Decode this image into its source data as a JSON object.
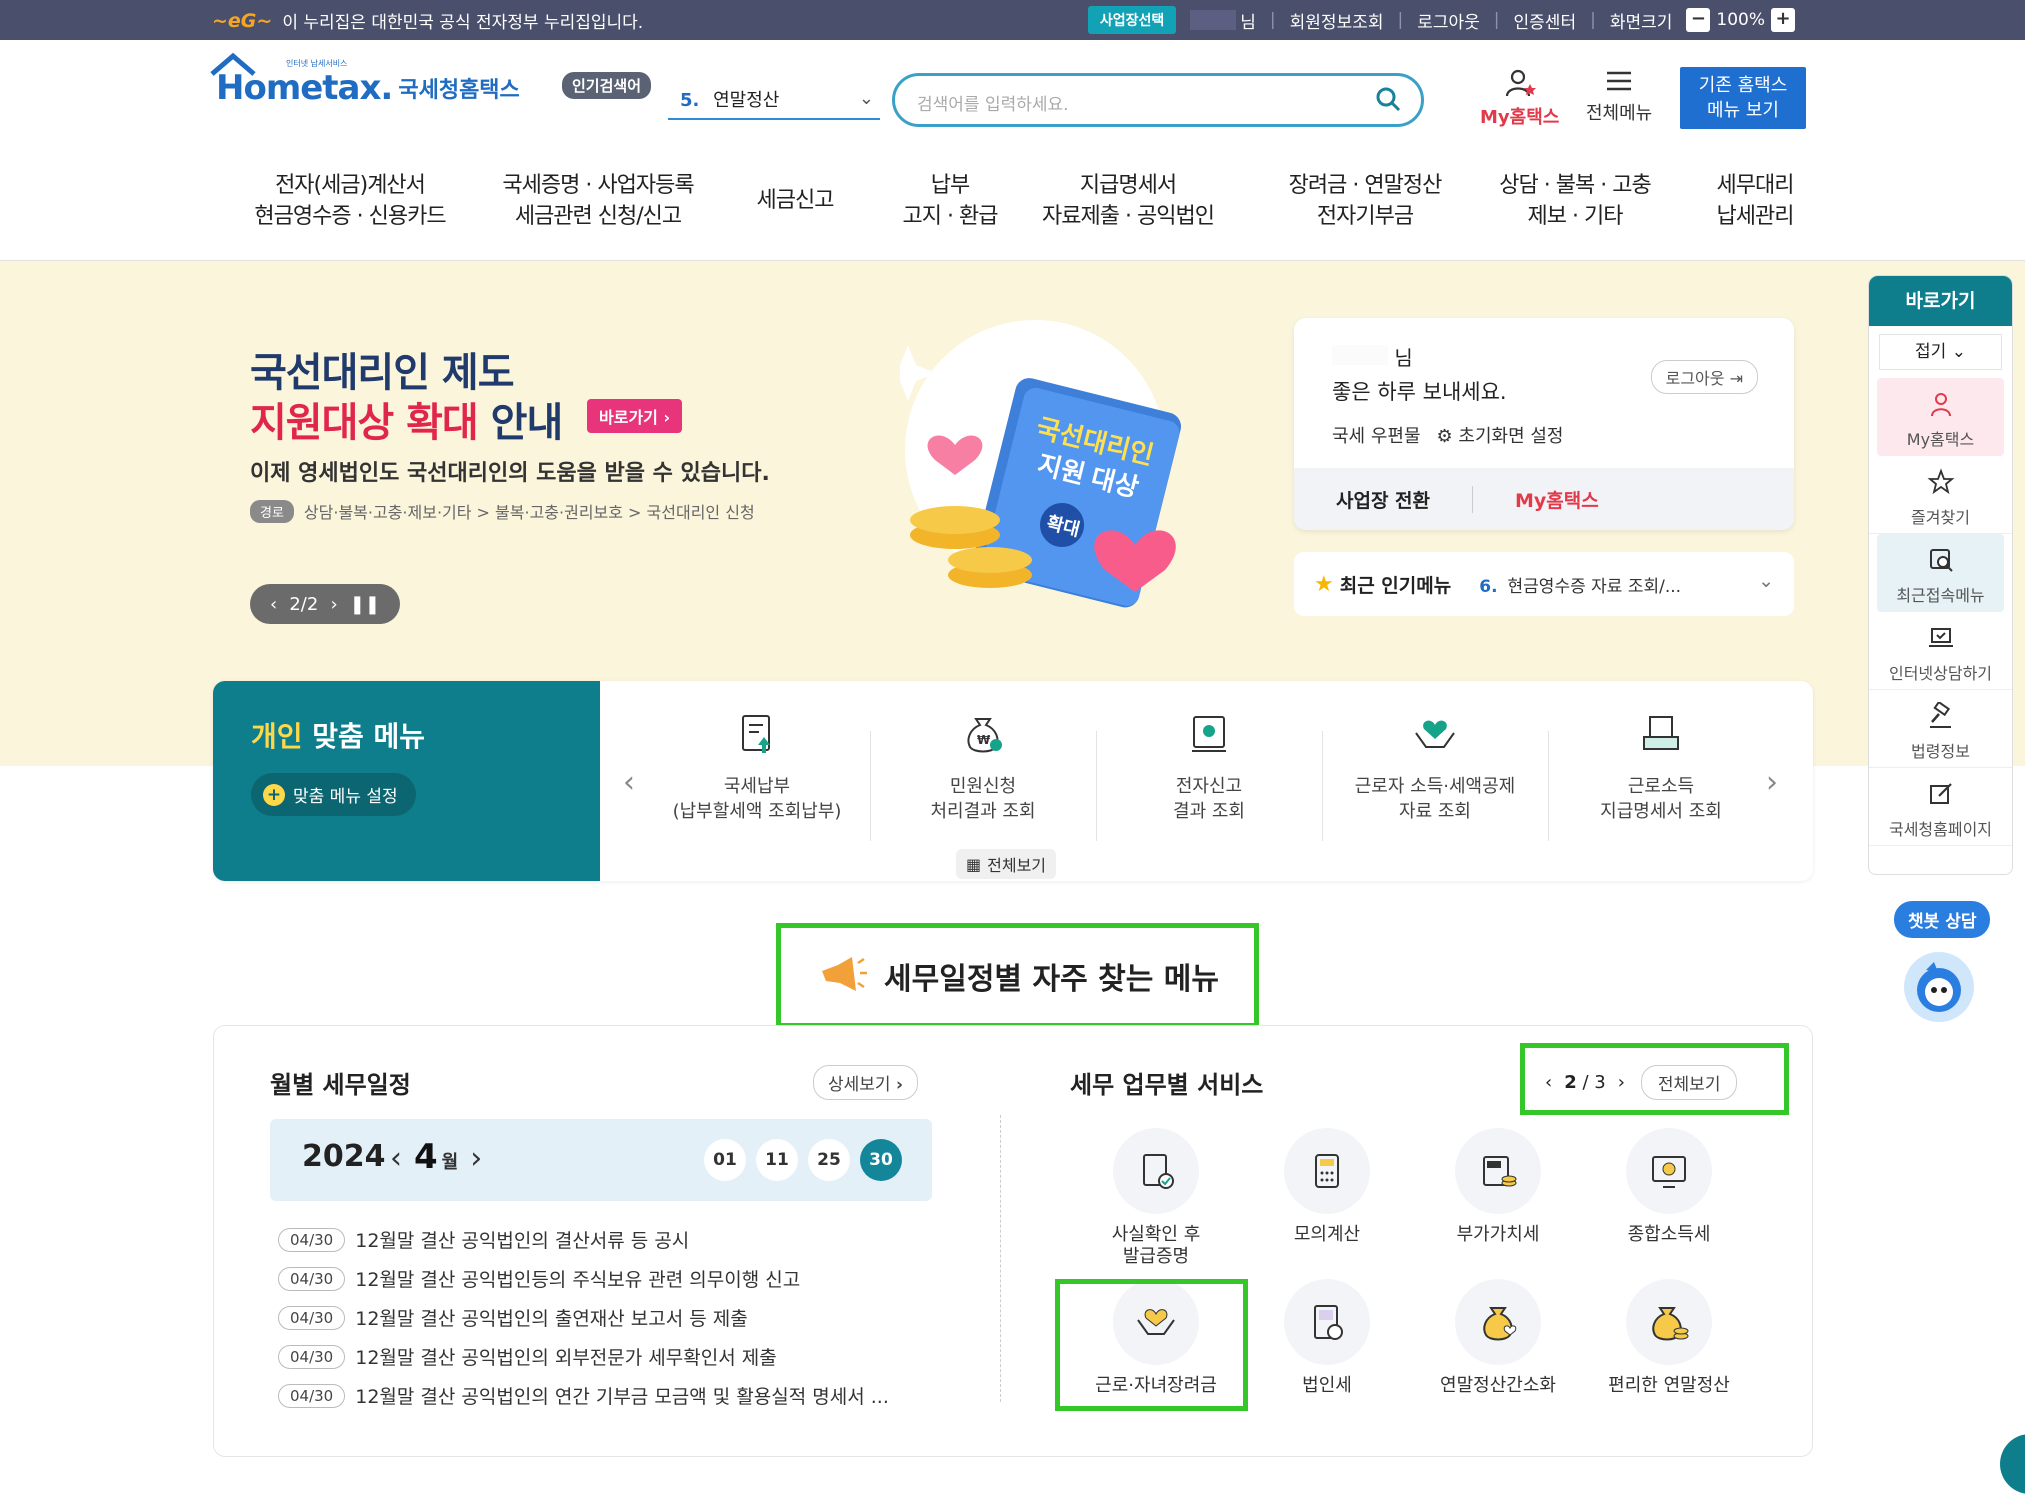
{
  "topbar": {
    "gov_notice": "이 누리집은 대한민국 공식 전자정부 누리집입니다.",
    "biz_select": "사업장선택",
    "user_suffix": "님",
    "member_info": "회원정보조회",
    "logout": "로그아웃",
    "cert_center": "인증센터",
    "screen_size": "화면크기",
    "zoom": "100%"
  },
  "header": {
    "logo_small": "인터넷 납세서비스",
    "logo_main": "Hometax.",
    "logo_kr": "국세청홈택스",
    "popular_badge": "인기검색어",
    "popular_num": "5.",
    "popular_term": "연말정산",
    "search_placeholder": "검색어를 입력하세요.",
    "my_hometax": "My홈택스",
    "all_menu": "전체메뉴",
    "old_menu_1": "기존 홈택스",
    "old_menu_2": "메뉴 보기"
  },
  "nav": [
    {
      "l1": "전자(세금)계산서",
      "l2": "현금영수증 · 신용카드"
    },
    {
      "l1": "국세증명 · 사업자등록",
      "l2": "세금관련 신청/신고"
    },
    {
      "l1": "세금신고",
      "l2": ""
    },
    {
      "l1": "납부",
      "l2": "고지 · 환급"
    },
    {
      "l1": "지급명세서",
      "l2": "자료제출 · 공익법인"
    },
    {
      "l1": "장려금 · 연말정산",
      "l2": "전자기부금"
    },
    {
      "l1": "상담 · 불복 · 고충",
      "l2": "제보 · 기타"
    },
    {
      "l1": "세무대리",
      "l2": "납세관리"
    }
  ],
  "banner": {
    "title1": "국선대리인 제도",
    "title2_red": "지원대상 확대",
    "title2_rest": " 안내",
    "go_button": "바로가기 ›",
    "subtitle": "이제 영세법인도 국선대리인의 도움을 받을 수 있습니다.",
    "path_tag": "경로",
    "path": "상담·불복·고충·제보·기타 > 불복·고충·권리보호 > 국선대리인 신청",
    "slide_counter": "2/2",
    "book_line1": "국선대리인",
    "book_line2": "지원 대상",
    "book_badge": "확대"
  },
  "login_card": {
    "name_suffix": "님",
    "greeting": "좋은 하루 보내세요.",
    "logout": "로그아웃",
    "mail": "국세 우편물",
    "init_setting": "초기화면 설정",
    "switch_biz": "사업장 전환",
    "my_hometax": "My홈택스"
  },
  "fav_bar": {
    "label": "최근 인기메뉴",
    "num": "6.",
    "value": "현금영수증 자료 조회/..."
  },
  "personal_menu": {
    "title_hl": "개인",
    "title_rest": " 맞춤 메뉴",
    "setting": "맞춤 메뉴 설정",
    "view_all": "전체보기",
    "items": [
      {
        "l1": "국세납부",
        "l2": "(납부할세액 조회납부)",
        "icon": "tax-payment-icon"
      },
      {
        "l1": "민원신청",
        "l2": "처리결과 조회",
        "icon": "money-bag-icon"
      },
      {
        "l1": "전자신고",
        "l2": "결과 조회",
        "icon": "e-filing-icon"
      },
      {
        "l1": "근로자 소득·세액공제",
        "l2": "자료 조회",
        "icon": "heart-hands-icon"
      },
      {
        "l1": "근로소득",
        "l2": "지급명세서 조회",
        "icon": "document-tray-icon"
      }
    ]
  },
  "section_heading": "세무일정별 자주 찾는 메뉴",
  "schedule": {
    "title": "월별 세무일정",
    "detail": "상세보기",
    "year": "2024",
    "month": "4",
    "month_unit": "월",
    "days": [
      "01",
      "11",
      "25",
      "30"
    ],
    "active_day": "30",
    "rows": [
      {
        "date": "04/30",
        "text": "12월말 결산 공익법인의 결산서류 등 공시"
      },
      {
        "date": "04/30",
        "text": "12월말 결산 공익법인등의 주식보유 관련 의무이행 신고"
      },
      {
        "date": "04/30",
        "text": "12월말 결산 공익법인의 출연재산 보고서 등 제출"
      },
      {
        "date": "04/30",
        "text": "12월말 결산 공익법인의 외부전문가 세무확인서 제출"
      },
      {
        "date": "04/30",
        "text": "12월말 결산 공익법인의 연간 기부금 모금액 및 활용실적 명세서 ..."
      }
    ]
  },
  "services": {
    "title": "세무 업무별 서비스",
    "page_cur": "2",
    "page_total": "3",
    "view_all": "전체보기",
    "items": [
      {
        "label": "사실확인 후 발급증명",
        "icon": "certificate-check-icon"
      },
      {
        "label": "모의계산",
        "icon": "calculator-icon"
      },
      {
        "label": "부가가치세",
        "icon": "vat-icon"
      },
      {
        "label": "종합소득세",
        "icon": "income-tax-monitor-icon"
      },
      {
        "label": "근로·자녀장려금",
        "icon": "heart-hands-icon"
      },
      {
        "label": "법인세",
        "icon": "corporate-tax-icon"
      },
      {
        "label": "연말정산간소화",
        "icon": "money-bag-heart-icon"
      },
      {
        "label": "편리한 연말정산",
        "icon": "money-bag-coins-icon"
      }
    ]
  },
  "quick_panel": {
    "title": "바로가기",
    "fold": "접기",
    "items": [
      "My홈택스",
      "즐겨찾기",
      "최근접속메뉴",
      "인터넷상담하기",
      "법령정보",
      "국세청홈페이지"
    ]
  },
  "chatbot": "챗봇 상담",
  "colors": {
    "topbar": "#4a4f6b",
    "teal": "#0e7e8c",
    "brand_blue": "#1f6cc2",
    "highlight_green": "#35c72a",
    "banner_bg": "#fbf5dc",
    "accent_red": "#e23a4a"
  }
}
